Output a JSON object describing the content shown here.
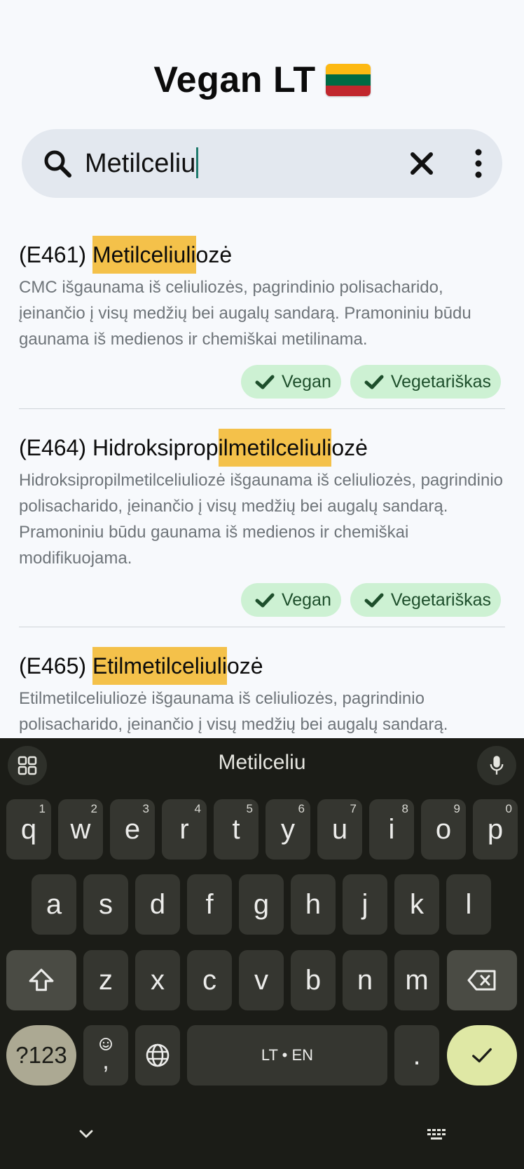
{
  "app": {
    "title": "Vegan LT",
    "flag_colors": [
      "#fdb913",
      "#006a44",
      "#c1272d"
    ]
  },
  "search": {
    "value": "Metilceliu",
    "icons": [
      "search-icon",
      "close-icon",
      "more-vert-icon"
    ]
  },
  "results": [
    {
      "code": "(E461) ",
      "pre": "",
      "match": "Metilceliuli",
      "post": "ozė",
      "description": "CMC išgaunama iš celiuliozės, pagrindinio polisacharido, įeinančio į visų medžių bei augalų sandarą. Pramoniniu būdu gaunama iš medienos ir chemiškai metilinama.",
      "tags": [
        "Vegan",
        "Vegetariškas"
      ]
    },
    {
      "code": "(E464) ",
      "pre": "Hidroksiprop",
      "match": "ilmetilceliuli",
      "post": "ozė",
      "description": "Hidroksipropilmetilceliuliozė išgaunama iš celiuliozės, pagrindinio polisacharido, įeinančio į visų medžių bei augalų sandarą. Pramoniniu būdu gaunama iš medienos ir chemiškai modifikuojama.",
      "tags": [
        "Vegan",
        "Vegetariškas"
      ]
    },
    {
      "code": "(E465) ",
      "pre": "",
      "match": "Etilmetilceliuli",
      "post": "ozė",
      "description": "Etilmetilceliuliozė išgaunama iš celiuliozės, pagrindinio polisacharido, įeinančio į visų medžių bei augalų sandarą.",
      "tags": []
    }
  ],
  "keyboard": {
    "suggestion": "Metilceliu",
    "row1": [
      {
        "k": "q",
        "n": "1"
      },
      {
        "k": "w",
        "n": "2"
      },
      {
        "k": "e",
        "n": "3"
      },
      {
        "k": "r",
        "n": "4"
      },
      {
        "k": "t",
        "n": "5"
      },
      {
        "k": "y",
        "n": "6"
      },
      {
        "k": "u",
        "n": "7"
      },
      {
        "k": "i",
        "n": "8"
      },
      {
        "k": "o",
        "n": "9"
      },
      {
        "k": "p",
        "n": "0"
      }
    ],
    "row2": [
      "a",
      "s",
      "d",
      "f",
      "g",
      "h",
      "j",
      "k",
      "l"
    ],
    "row3": [
      "z",
      "x",
      "c",
      "v",
      "b",
      "n",
      "m"
    ],
    "symbols_label": "?123",
    "comma_label": ",",
    "space_label": "LT • EN",
    "period_label": ".",
    "colors": {
      "background": "#1b1c17",
      "key": "#353630",
      "enter": "#dfe8a5",
      "symbols": "#aca993"
    }
  }
}
